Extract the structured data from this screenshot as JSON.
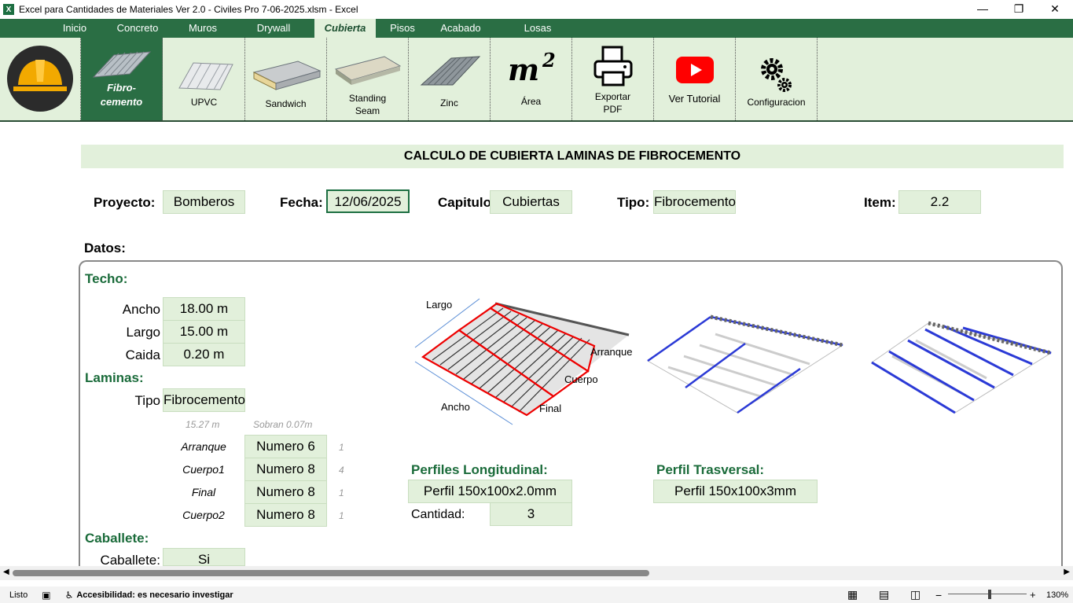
{
  "window": {
    "title": "Excel para Cantidades de Materiales Ver 2.0 - Civiles Pro 7-06-2025.xlsm - Excel",
    "app_icon": "X",
    "controls": [
      "—",
      "❐",
      "✕"
    ]
  },
  "tabs": [
    "Inicio",
    "Concreto",
    "Muros",
    "Drywall",
    "Cubierta",
    "Pisos",
    "Acabado",
    "Losas"
  ],
  "ribbon": {
    "fibro_line1": "Fibro-",
    "fibro_line2": "cemento",
    "upvc": "UPVC",
    "sandwich": "Sandwich",
    "standing_line1": "Standing",
    "standing_line2": "Seam",
    "zinc": "Zinc",
    "area_symbol": "m",
    "area_exp": "2",
    "area": "Área",
    "pdf_line1": "Exportar",
    "pdf_line2": "PDF",
    "tutorial": "Ver Tutorial",
    "config": "Configuracion"
  },
  "sheet": {
    "title": "CALCULO DE CUBIERTA LAMINAS DE FIBROCEMENTO",
    "proyecto_label": "Proyecto:",
    "proyecto": "Bomberos",
    "fecha_label": "Fecha:",
    "fecha": "12/06/2025",
    "capitulo_label": "Capitulo",
    "capitulo": "Cubiertas",
    "tipo_label": "Tipo:",
    "tipo": "Fibrocemento",
    "item_label": "Item:",
    "item": "2.2",
    "datos_label": "Datos:",
    "techo_label": "Techo:",
    "ancho_label": "Ancho",
    "ancho": "18.00 m",
    "largo_label": "Largo",
    "largo": "15.00 m",
    "caida_label": "Caida",
    "caida": "0.20 m",
    "laminas_label": "Laminas:",
    "lam_tipo_label": "Tipo",
    "lam_tipo": "Fibrocemento",
    "hint_len": "15.27 m",
    "hint_sobran": "Sobran 0.07m",
    "arranque_label": "Arranque",
    "arranque": "Numero 6",
    "arranque_n": "1",
    "cuerpo1_label": "Cuerpo1",
    "cuerpo1": "Numero 8",
    "cuerpo1_n": "4",
    "final_label": "Final",
    "final": "Numero 8",
    "final_n": "1",
    "cuerpo2_label": "Cuerpo2",
    "cuerpo2": "Numero 8",
    "cuerpo2_n": "1",
    "caballete_label": "Caballete:",
    "caballete_row_label": "Caballete:",
    "caballete": "Si",
    "perf_long_label": "Perfiles Longitudinal:",
    "perf_long": "Perfil 150x100x2.0mm",
    "cantidad_label": "Cantidad:",
    "cantidad": "3",
    "perf_trans_label": "Perfil Trasversal:",
    "perf_trans": "Perfil 150x100x3mm",
    "diagram": {
      "largo": "Largo",
      "arranque": "Arranque",
      "cuerpo": "Cuerpo",
      "ancho": "Ancho",
      "final": "Final"
    }
  },
  "status": {
    "ready": "Listo",
    "accessibility": "Accesibilidad: es necesario investigar",
    "zoom": "130%"
  }
}
